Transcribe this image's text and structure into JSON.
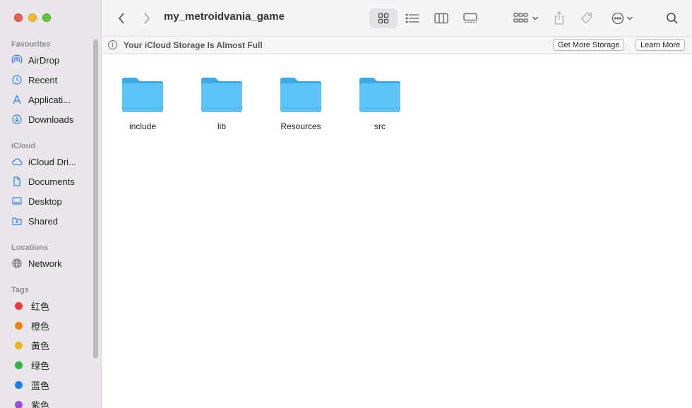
{
  "window": {
    "title": "my_metroidvania_game"
  },
  "sidebar": {
    "sections": {
      "favourites": "Favourites",
      "icloud": "iCloud",
      "locations": "Locations",
      "tags": "Tags"
    },
    "favourites": [
      {
        "label": "AirDrop",
        "icon": "airdrop-icon"
      },
      {
        "label": "Recent",
        "icon": "clock-icon"
      },
      {
        "label": "Applicati...",
        "icon": "applications-icon"
      },
      {
        "label": "Downloads",
        "icon": "download-icon"
      }
    ],
    "icloud": [
      {
        "label": "iCloud Dri...",
        "icon": "cloud-icon"
      },
      {
        "label": "Documents",
        "icon": "document-icon"
      },
      {
        "label": "Desktop",
        "icon": "desktop-icon"
      },
      {
        "label": "Shared",
        "icon": "shared-folder-icon"
      }
    ],
    "locations": [
      {
        "label": "Network",
        "icon": "globe-icon"
      }
    ],
    "tags": [
      {
        "label": "红色",
        "color": "#ee3b3b"
      },
      {
        "label": "橙色",
        "color": "#f0821e"
      },
      {
        "label": "黄色",
        "color": "#e9b51c"
      },
      {
        "label": "绿色",
        "color": "#2fb342"
      },
      {
        "label": "蓝色",
        "color": "#1f78f0"
      },
      {
        "label": "紫色",
        "color": "#a04ed1"
      }
    ]
  },
  "toolbar": {
    "view_modes": [
      "icon-view",
      "list-view",
      "column-view",
      "gallery-view"
    ],
    "active_view": "icon-view"
  },
  "banner": {
    "message": "Your iCloud Storage Is Almost Full",
    "primary_button": "Get More Storage",
    "secondary_button": "Learn More"
  },
  "files": [
    {
      "name": "include"
    },
    {
      "name": "lib"
    },
    {
      "name": "Resources"
    },
    {
      "name": "src"
    }
  ],
  "colors": {
    "folder": "#5ec4f7",
    "folder_dark": "#3fa9e3",
    "accent": "#2f7ff0"
  }
}
